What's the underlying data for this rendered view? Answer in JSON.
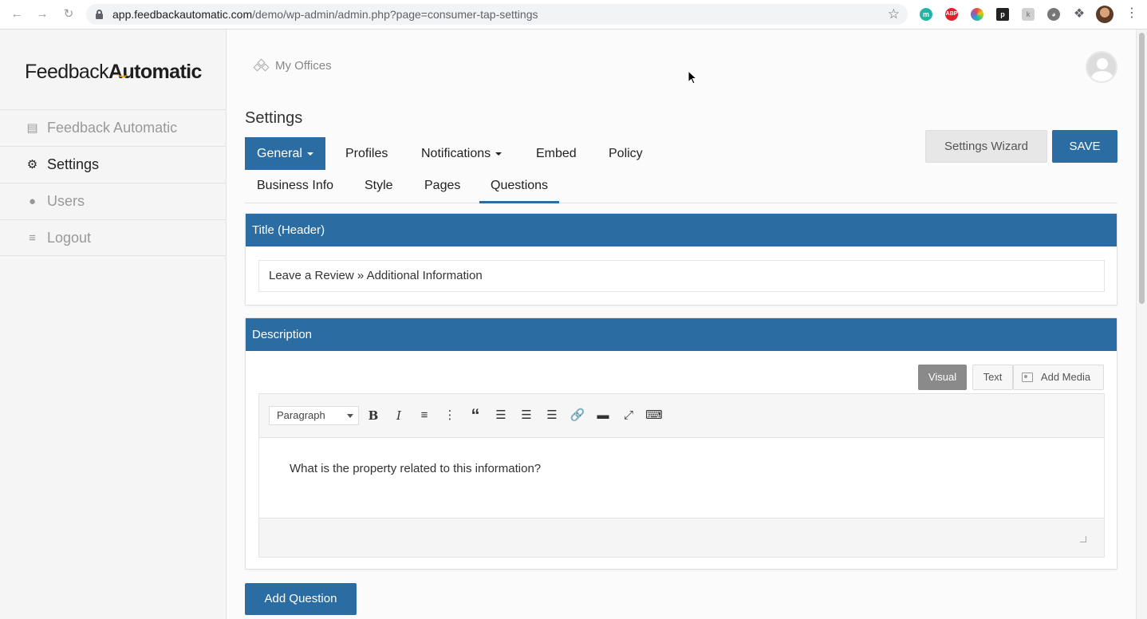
{
  "browser": {
    "url_host": "app.feedbackautomatic.com",
    "url_path": "/demo/wp-admin/admin.php?page=consumer-tap-settings",
    "extensions": [
      "m",
      "ABP",
      "color",
      "p",
      "k",
      "cat",
      "puzzle"
    ]
  },
  "sidebar": {
    "logo_regular": "Feedback",
    "logo_bold": "Automatic",
    "items": [
      {
        "label": "Feedback Automatic",
        "icon": "dashboard-icon",
        "active": false
      },
      {
        "label": "Settings",
        "icon": "gear-icon",
        "active": true
      },
      {
        "label": "Users",
        "icon": "user-icon",
        "active": false
      },
      {
        "label": "Logout",
        "icon": "logout-icon",
        "active": false
      }
    ]
  },
  "header": {
    "breadcrumb": "My Offices"
  },
  "page": {
    "title": "Settings",
    "tabs": [
      {
        "label": "General",
        "active": true,
        "dropdown": true
      },
      {
        "label": "Profiles",
        "active": false,
        "dropdown": false
      },
      {
        "label": "Notifications",
        "active": false,
        "dropdown": true
      },
      {
        "label": "Embed",
        "active": false,
        "dropdown": false
      },
      {
        "label": "Policy",
        "active": false,
        "dropdown": false
      }
    ],
    "subtabs": [
      {
        "label": "Business Info",
        "active": false
      },
      {
        "label": "Style",
        "active": false
      },
      {
        "label": "Pages",
        "active": false
      },
      {
        "label": "Questions",
        "active": true
      }
    ],
    "wizard_label": "Settings Wizard",
    "save_label": "SAVE"
  },
  "title_panel": {
    "heading": "Title (Header)",
    "value": "Leave a Review » Additional Information"
  },
  "description_panel": {
    "heading": "Description",
    "editor_tabs": {
      "visual": "Visual",
      "text": "Text",
      "media": "Add Media"
    },
    "format": "Paragraph",
    "toolbar": [
      "bold",
      "italic",
      "bullet-list",
      "numbered-list",
      "blockquote",
      "align-left",
      "align-center",
      "align-right",
      "link",
      "read-more",
      "fullscreen",
      "toolbar-toggle"
    ],
    "content": "What is the property related to this information?"
  },
  "add_question_label": "Add Question",
  "colors": {
    "primary": "#2b6ca3",
    "visual_tab": "#8a8a8a",
    "sidebar_bg": "#f5f5f5"
  }
}
